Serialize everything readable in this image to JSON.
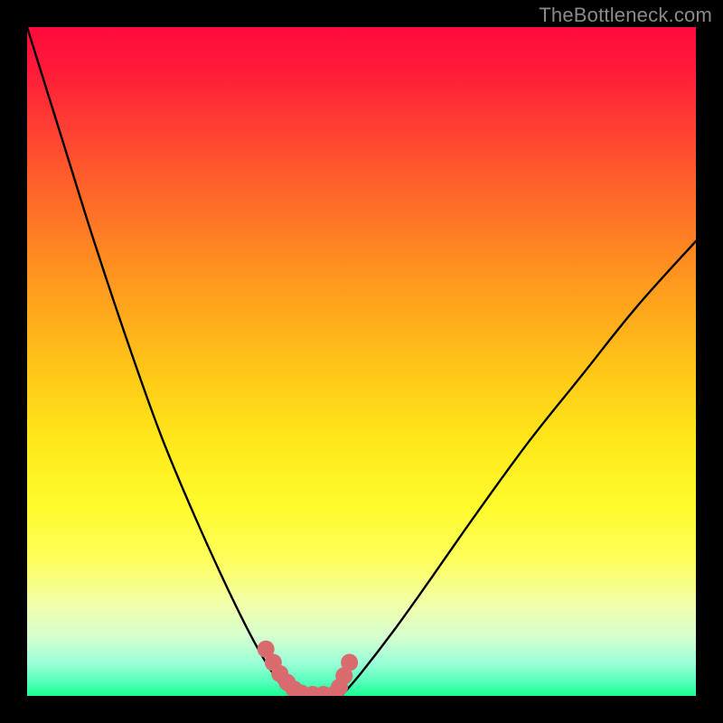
{
  "watermark": "TheBottleneck.com",
  "colors": {
    "background": "#000000",
    "curve": "#000000",
    "marker": "#d96a6e"
  },
  "chart_data": {
    "type": "line",
    "title": "",
    "xlabel": "",
    "ylabel": "",
    "xlim": [
      0,
      100
    ],
    "ylim": [
      0,
      100
    ],
    "note": "Axis values are estimated from pixel positions; no numeric tick labels are visible in the image.",
    "series": [
      {
        "name": "left-curve",
        "x": [
          0,
          5,
          10,
          15,
          20,
          25,
          30,
          34,
          37,
          39.5
        ],
        "y": [
          100,
          84,
          68,
          53,
          39,
          27,
          16,
          8,
          3,
          0
        ]
      },
      {
        "name": "right-curve",
        "x": [
          47,
          50,
          55,
          60,
          67,
          75,
          83,
          91,
          100
        ],
        "y": [
          0,
          3.5,
          10,
          17,
          27,
          38,
          48,
          58,
          68
        ]
      },
      {
        "name": "bottom-markers",
        "x": [
          35.7,
          36.8,
          37.8,
          38.9,
          39.9,
          41.0,
          42.7,
          44.3,
          46.0,
          46.7,
          47.4,
          48.2
        ],
        "y": [
          7.0,
          5.0,
          3.3,
          2.0,
          1.0,
          0.4,
          0.2,
          0.2,
          0.3,
          1.3,
          3.0,
          5.0
        ]
      }
    ]
  }
}
